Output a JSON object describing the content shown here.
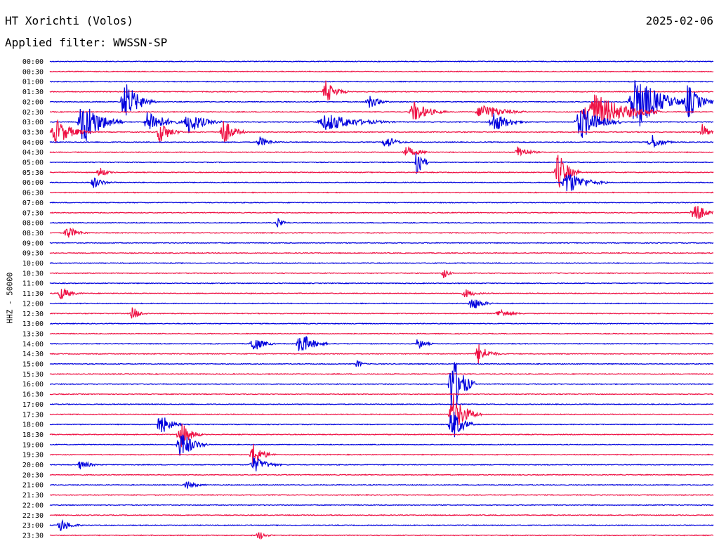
{
  "header": {
    "station": "HT Xorichti (Volos)",
    "date": "2025-02-06",
    "filter_prefix": "Applied filter:",
    "filter_name": "WWSSN-SP"
  },
  "channel_label": "HHZ - 50000",
  "colors": {
    "blue": "#0000dd",
    "red": "#ee1144"
  },
  "chart_data": {
    "type": "line",
    "title": "HT Xorichti (Volos)",
    "date": "2025-02-06",
    "filter": "WWSSN-SP",
    "ylabel": "HHZ - 50000",
    "xlabel": "",
    "grid": false,
    "line_colors": [
      "blue",
      "red"
    ],
    "tick_labels": [
      "00:00",
      "00:30",
      "01:00",
      "01:30",
      "02:00",
      "02:30",
      "03:00",
      "03:30",
      "04:00",
      "04:30",
      "05:00",
      "05:30",
      "06:00",
      "06:30",
      "07:00",
      "07:30",
      "08:00",
      "08:30",
      "09:00",
      "09:30",
      "10:00",
      "10:30",
      "11:00",
      "11:30",
      "12:00",
      "12:30",
      "13:00",
      "13:30",
      "14:00",
      "14:30",
      "15:00",
      "15:30",
      "16:00",
      "16:30",
      "17:00",
      "17:30",
      "18:00",
      "18:30",
      "19:00",
      "19:30",
      "20:00",
      "20:30",
      "21:00",
      "21:30",
      "22:00",
      "22:30",
      "23:00",
      "23:30"
    ],
    "events": [
      {
        "line": "02:00",
        "start": 0.105,
        "end": 0.16,
        "amp": 3.5
      },
      {
        "line": "02:00",
        "start": 0.475,
        "end": 0.515,
        "amp": 1.2
      },
      {
        "line": "02:00",
        "start": 0.87,
        "end": 0.96,
        "amp": 5
      },
      {
        "line": "02:00",
        "start": 0.955,
        "end": 1.0,
        "amp": 3.2
      },
      {
        "line": "01:30",
        "start": 0.41,
        "end": 0.45,
        "amp": 2
      },
      {
        "line": "02:30",
        "start": 0.54,
        "end": 0.6,
        "amp": 1.8
      },
      {
        "line": "02:30",
        "start": 0.64,
        "end": 0.72,
        "amp": 1.5
      },
      {
        "line": "02:30",
        "start": 0.8,
        "end": 0.92,
        "amp": 3.5
      },
      {
        "line": "03:00",
        "start": 0.04,
        "end": 0.11,
        "amp": 4
      },
      {
        "line": "03:00",
        "start": 0.14,
        "end": 0.2,
        "amp": 2.2
      },
      {
        "line": "03:00",
        "start": 0.2,
        "end": 0.26,
        "amp": 2
      },
      {
        "line": "03:00",
        "start": 0.4,
        "end": 0.52,
        "amp": 1.5
      },
      {
        "line": "03:00",
        "start": 0.66,
        "end": 0.72,
        "amp": 1.8
      },
      {
        "line": "03:00",
        "start": 0.79,
        "end": 0.86,
        "amp": 3
      },
      {
        "line": "03:30",
        "start": 0,
        "end": 0.065,
        "amp": 2.2
      },
      {
        "line": "03:30",
        "start": 0.16,
        "end": 0.2,
        "amp": 2
      },
      {
        "line": "03:30",
        "start": 0.255,
        "end": 0.295,
        "amp": 2.5
      },
      {
        "line": "03:30",
        "start": 0.98,
        "end": 1.0,
        "amp": 2
      },
      {
        "line": "04:00",
        "start": 0.31,
        "end": 0.35,
        "amp": 1
      },
      {
        "line": "04:00",
        "start": 0.5,
        "end": 0.54,
        "amp": 1.2
      },
      {
        "line": "04:00",
        "start": 0.9,
        "end": 0.94,
        "amp": 1.5
      },
      {
        "line": "04:30",
        "start": 0.53,
        "end": 0.58,
        "amp": 1
      },
      {
        "line": "04:30",
        "start": 0.7,
        "end": 0.74,
        "amp": 1.2
      },
      {
        "line": "05:00",
        "start": 0.55,
        "end": 0.57,
        "amp": 4
      },
      {
        "line": "05:30",
        "start": 0.07,
        "end": 0.1,
        "amp": 1
      },
      {
        "line": "05:30",
        "start": 0.76,
        "end": 0.8,
        "amp": 3.5
      },
      {
        "line": "06:00",
        "start": 0.06,
        "end": 0.1,
        "amp": 1
      },
      {
        "line": "06:00",
        "start": 0.77,
        "end": 0.84,
        "amp": 2
      },
      {
        "line": "07:30",
        "start": 0.965,
        "end": 1.0,
        "amp": 2.5
      },
      {
        "line": "08:00",
        "start": 0.34,
        "end": 0.36,
        "amp": 1
      },
      {
        "line": "08:30",
        "start": 0.02,
        "end": 0.06,
        "amp": 1.2
      },
      {
        "line": "10:30",
        "start": 0.59,
        "end": 0.61,
        "amp": 1
      },
      {
        "line": "11:30",
        "start": 0.01,
        "end": 0.05,
        "amp": 1.2
      },
      {
        "line": "11:30",
        "start": 0.62,
        "end": 0.66,
        "amp": 0.8
      },
      {
        "line": "12:00",
        "start": 0.63,
        "end": 0.67,
        "amp": 1.3
      },
      {
        "line": "12:30",
        "start": 0.12,
        "end": 0.15,
        "amp": 1.2
      },
      {
        "line": "12:30",
        "start": 0.67,
        "end": 0.72,
        "amp": 0.8
      },
      {
        "line": "14:00",
        "start": 0.3,
        "end": 0.34,
        "amp": 1.5
      },
      {
        "line": "14:00",
        "start": 0.37,
        "end": 0.42,
        "amp": 2
      },
      {
        "line": "14:00",
        "start": 0.55,
        "end": 0.58,
        "amp": 1
      },
      {
        "line": "14:30",
        "start": 0.64,
        "end": 0.68,
        "amp": 1.8
      },
      {
        "line": "15:00",
        "start": 0.46,
        "end": 0.48,
        "amp": 0.8
      },
      {
        "line": "16:00",
        "start": 0.6,
        "end": 0.64,
        "amp": 6
      },
      {
        "line": "17:30",
        "start": 0.6,
        "end": 0.65,
        "amp": 3.5
      },
      {
        "line": "18:00",
        "start": 0.16,
        "end": 0.2,
        "amp": 2
      },
      {
        "line": "18:00",
        "start": 0.6,
        "end": 0.64,
        "amp": 3
      },
      {
        "line": "18:30",
        "start": 0.19,
        "end": 0.23,
        "amp": 2.5
      },
      {
        "line": "19:00",
        "start": 0.19,
        "end": 0.24,
        "amp": 2.5
      },
      {
        "line": "19:30",
        "start": 0.3,
        "end": 0.34,
        "amp": 2
      },
      {
        "line": "20:00",
        "start": 0.04,
        "end": 0.08,
        "amp": 0.8
      },
      {
        "line": "20:00",
        "start": 0.3,
        "end": 0.35,
        "amp": 1.5
      },
      {
        "line": "21:00",
        "start": 0.2,
        "end": 0.24,
        "amp": 0.8
      },
      {
        "line": "23:00",
        "start": 0.01,
        "end": 0.05,
        "amp": 1.2
      },
      {
        "line": "23:30",
        "start": 0.31,
        "end": 0.34,
        "amp": 0.8
      }
    ]
  }
}
